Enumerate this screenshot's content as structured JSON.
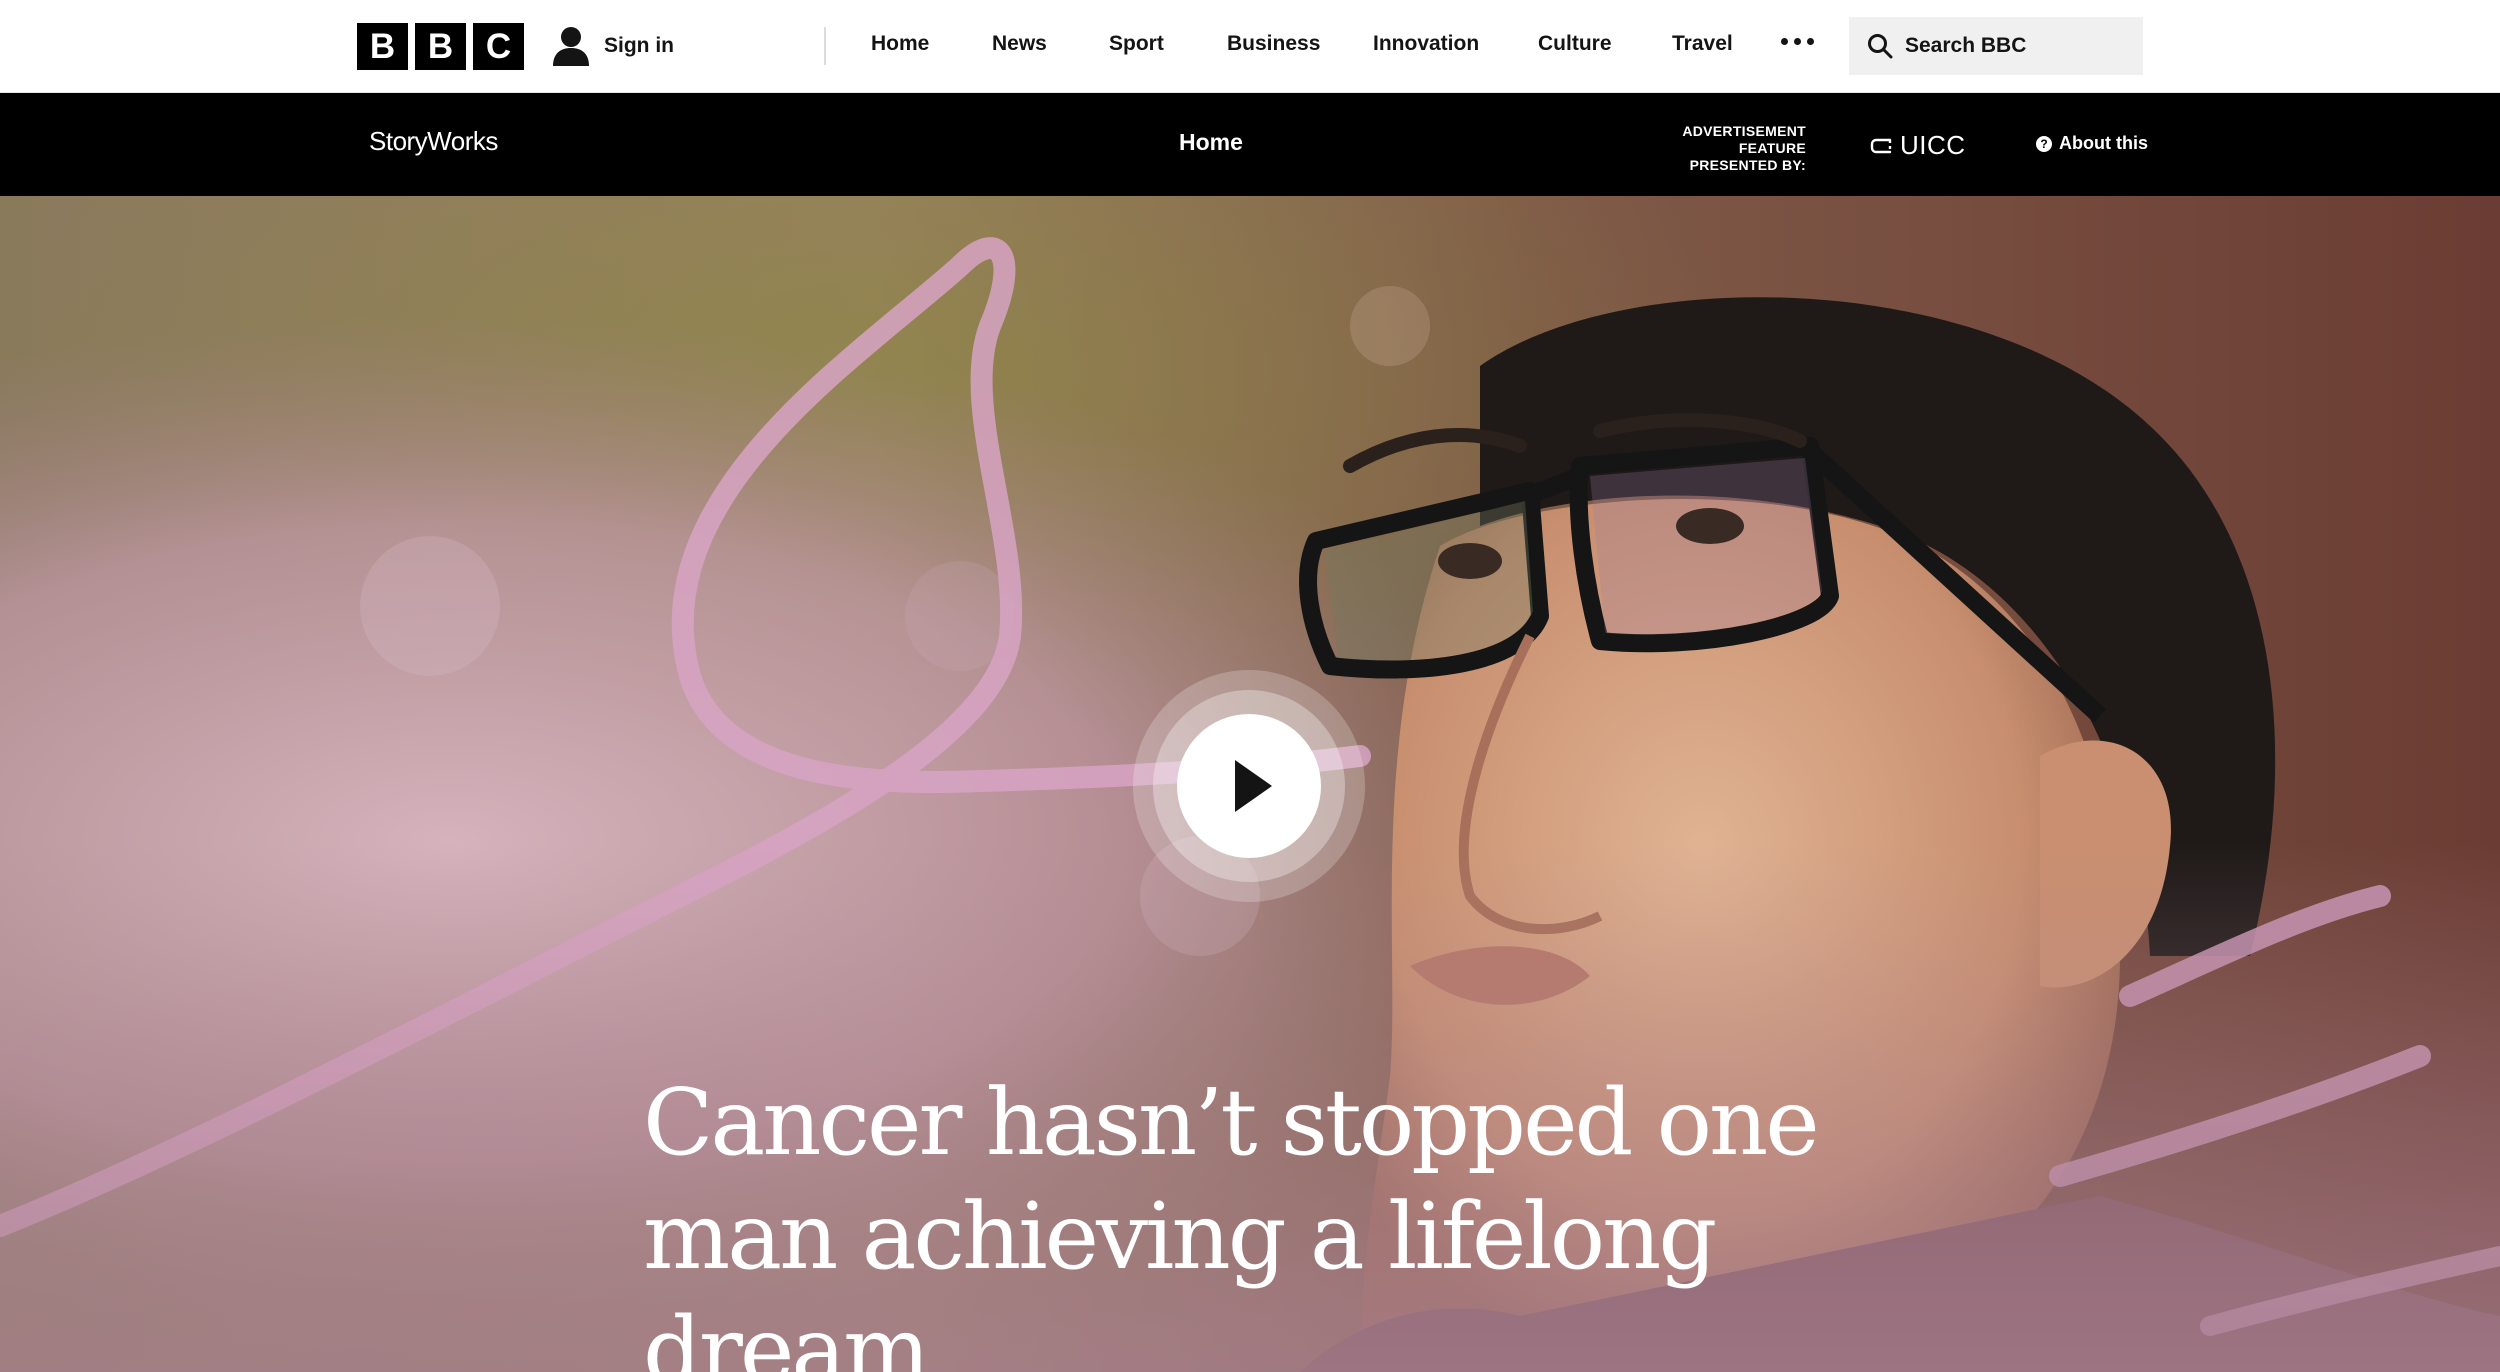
{
  "header": {
    "logo_letters": [
      "B",
      "B",
      "C"
    ],
    "sign_in_label": "Sign in",
    "nav_items": [
      {
        "label": "Home"
      },
      {
        "label": "News"
      },
      {
        "label": "Sport"
      },
      {
        "label": "Business"
      },
      {
        "label": "Innovation"
      },
      {
        "label": "Culture"
      },
      {
        "label": "Travel"
      }
    ],
    "more_icon": "more-dots-icon",
    "search_icon": "search-icon",
    "search_label": "Search BBC"
  },
  "storyworks_bar": {
    "brand": "StoryWorks",
    "home_label": "Home",
    "ad_line1": "ADVERTISEMENT",
    "ad_line2": "FEATURE",
    "ad_line3": "PRESENTED BY:",
    "sponsor": "UICC",
    "about_label": "About this",
    "about_icon": "help-icon",
    "about_icon_glyph": "?"
  },
  "hero": {
    "headline_line1": "Cancer hasn’t stopped one",
    "headline_line2": "man achieving a lifelong dream",
    "play_icon": "play-icon",
    "accent_color": "#d7a3c3"
  }
}
